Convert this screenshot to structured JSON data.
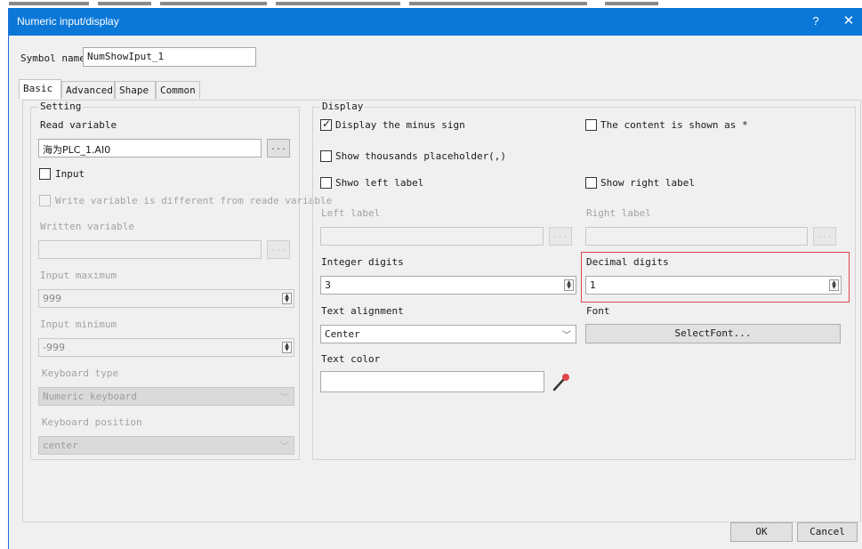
{
  "window": {
    "title": "Numeric input/display",
    "help": "?",
    "close": "✕"
  },
  "symbol": {
    "label": "Symbol name",
    "value": "NumShowIput_1"
  },
  "tabs": [
    {
      "label": "Basic",
      "active": true
    },
    {
      "label": "Advanced",
      "active": false
    },
    {
      "label": "Shape",
      "active": false
    },
    {
      "label": "Common",
      "active": false
    }
  ],
  "setting": {
    "legend": "Setting",
    "read_variable_label": "Read variable",
    "read_variable_value": "海为PLC_1.AI0",
    "browse": "...",
    "input_label": "Input",
    "input_checked": false,
    "write_diff_label": "Write variable is different from reade variable",
    "written_variable_label": "Written variable",
    "written_variable_value": "",
    "input_max_label": "Input maximum",
    "input_max_value": "999",
    "input_min_label": "Input minimum",
    "input_min_value": "-999",
    "keyboard_type_label": "Keyboard type",
    "keyboard_type_value": "Numeric keyboard",
    "keyboard_position_label": "Keyboard position",
    "keyboard_position_value": "center"
  },
  "display": {
    "legend": "Display",
    "minus_sign_label": "Display the minus sign",
    "minus_sign_checked": true,
    "content_star_label": "The content is shown as *",
    "content_star_checked": false,
    "thousands_label": "Show thousands placeholder(,)",
    "thousands_checked": false,
    "left_label_check": "Shwo left label",
    "right_label_check": "Show right label",
    "left_label": "Left label",
    "right_label": "Right label",
    "left_label_value": "",
    "right_label_value": "",
    "integer_digits_label": "Integer digits",
    "integer_digits_value": "3",
    "decimal_digits_label": "Decimal digits",
    "decimal_digits_value": "1",
    "text_alignment_label": "Text alignment",
    "text_alignment_value": "Center",
    "font_label": "Font",
    "select_font": "SelectFont...",
    "text_color_label": "Text color",
    "text_color_value": ""
  },
  "footer": {
    "ok": "OK",
    "cancel": "Cancel"
  },
  "colors": {
    "titlebar": "#0b78d8",
    "highlight": "#e0454a"
  }
}
